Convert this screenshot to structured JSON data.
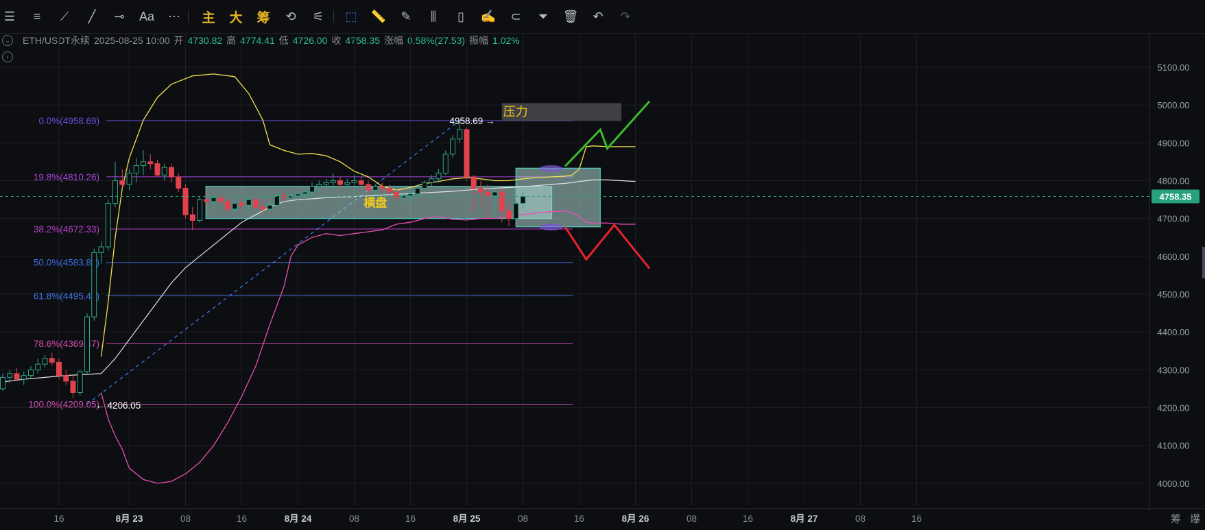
{
  "toolbar": {
    "items": [
      {
        "icon": "menu-icon",
        "glyph": "☰"
      },
      {
        "icon": "horizontal-lines-icon",
        "glyph": "≡"
      },
      {
        "icon": "trend-line-icon",
        "glyph": "⟋"
      },
      {
        "icon": "ray-line-icon",
        "glyph": "╱"
      },
      {
        "icon": "horizontal-ray-icon",
        "glyph": "⊸"
      },
      {
        "icon": "text-tool-icon",
        "glyph": "Aa"
      },
      {
        "icon": "more-icon",
        "glyph": "⋯"
      }
    ],
    "cn_buttons": [
      "主",
      "大",
      "筹"
    ],
    "tools": [
      {
        "icon": "rotate-icon",
        "glyph": "⟲"
      },
      {
        "icon": "signal-icon",
        "glyph": "⚟"
      },
      {
        "icon": "select-icon",
        "glyph": "⬚",
        "active": true
      },
      {
        "icon": "ruler-icon",
        "glyph": "📏"
      },
      {
        "icon": "brush-icon",
        "glyph": "✎"
      },
      {
        "icon": "candle-pattern-icon",
        "glyph": "⫼"
      },
      {
        "icon": "clipboard-icon",
        "glyph": "▯"
      },
      {
        "icon": "note-icon",
        "glyph": "✍"
      },
      {
        "icon": "magnet-icon",
        "glyph": "⊂"
      },
      {
        "icon": "filter-icon",
        "glyph": "⏷"
      },
      {
        "icon": "trash-icon",
        "glyph": "🗑"
      },
      {
        "icon": "undo-icon",
        "glyph": "↶"
      },
      {
        "icon": "redo-icon",
        "glyph": "↷",
        "disabled": true
      }
    ]
  },
  "infobar": {
    "symbol": "ETH/USDT永续",
    "datetime": "2025-08-25 10:00",
    "open_label": "开",
    "open": "4730.82",
    "high_label": "高",
    "high": "4774.41",
    "low_label": "低",
    "low": "4726.00",
    "close_label": "收",
    "close": "4758.35",
    "change_label": "涨幅",
    "change": "0.58%(27.53)",
    "amp_label": "振幅",
    "amp": "1.02%"
  },
  "corner": {
    "left": "筹",
    "right": "爆"
  },
  "colors": {
    "background": "#0d0e12",
    "up": "#2fa88a",
    "down": "#e0424e",
    "grid": "#1c1e23",
    "price_badge": "#26a17b"
  },
  "chart_data": {
    "type": "candlestick",
    "symbol": "ETH/USDT永续",
    "y_range": [
      3940,
      5170
    ],
    "y_ticks": [
      4000,
      4100,
      4200,
      4300,
      4400,
      4500,
      4600,
      4700,
      4800,
      4900,
      5000,
      5100
    ],
    "y_tick_labels": [
      "4000.00",
      "4100.00",
      "4200.00",
      "4300.00",
      "4400.00",
      "4500.00",
      "4600.00",
      "4700.00",
      "4800.00",
      "4900.00",
      "5000.00",
      "5100.00"
    ],
    "x_ticks": [
      {
        "label": "16",
        "bar": 8,
        "bold": false
      },
      {
        "label": "8月 23",
        "bar": 18,
        "bold": true
      },
      {
        "label": "08",
        "bar": 26,
        "bold": false
      },
      {
        "label": "16",
        "bar": 34,
        "bold": false
      },
      {
        "label": "8月 24",
        "bar": 42,
        "bold": true
      },
      {
        "label": "08",
        "bar": 50,
        "bold": false
      },
      {
        "label": "16",
        "bar": 58,
        "bold": false
      },
      {
        "label": "8月 25",
        "bar": 66,
        "bold": true
      },
      {
        "label": "08",
        "bar": 74,
        "bold": false
      },
      {
        "label": "16",
        "bar": 82,
        "bold": false
      },
      {
        "label": "8月 26",
        "bar": 90,
        "bold": true
      },
      {
        "label": "08",
        "bar": 98,
        "bold": false
      },
      {
        "label": "16",
        "bar": 106,
        "bold": false
      },
      {
        "label": "8月 27",
        "bar": 114,
        "bold": true
      },
      {
        "label": "08",
        "bar": 122,
        "bold": false
      },
      {
        "label": "16",
        "bar": 130,
        "bold": false
      }
    ],
    "current_price": 4758.35,
    "current_price_label": "4758.35",
    "candles": [
      [
        4250,
        4290,
        4245,
        4280
      ],
      [
        4280,
        4300,
        4265,
        4290
      ],
      [
        4290,
        4305,
        4270,
        4275
      ],
      [
        4275,
        4295,
        4260,
        4285
      ],
      [
        4285,
        4310,
        4275,
        4300
      ],
      [
        4300,
        4330,
        4290,
        4315
      ],
      [
        4315,
        4340,
        4305,
        4330
      ],
      [
        4330,
        4345,
        4310,
        4320
      ],
      [
        4320,
        4330,
        4275,
        4285
      ],
      [
        4285,
        4300,
        4260,
        4270
      ],
      [
        4270,
        4285,
        4225,
        4240
      ],
      [
        4240,
        4300,
        4232,
        4295
      ],
      [
        4295,
        4450,
        4290,
        4440
      ],
      [
        4440,
        4620,
        4430,
        4610
      ],
      [
        4610,
        4640,
        4580,
        4625
      ],
      [
        4625,
        4750,
        4615,
        4740
      ],
      [
        4740,
        4850,
        4730,
        4800
      ],
      [
        4800,
        4830,
        4780,
        4790
      ],
      [
        4790,
        4830,
        4775,
        4820
      ],
      [
        4820,
        4860,
        4795,
        4840
      ],
      [
        4840,
        4880,
        4815,
        4850
      ],
      [
        4850,
        4870,
        4830,
        4845
      ],
      [
        4845,
        4855,
        4810,
        4815
      ],
      [
        4815,
        4845,
        4800,
        4835
      ],
      [
        4835,
        4845,
        4795,
        4810
      ],
      [
        4810,
        4820,
        4770,
        4780
      ],
      [
        4780,
        4790,
        4700,
        4710
      ],
      [
        4710,
        4730,
        4670,
        4695
      ],
      [
        4695,
        4760,
        4690,
        4750
      ],
      [
        4750,
        4770,
        4730,
        4745
      ],
      [
        4745,
        4760,
        4725,
        4755
      ],
      [
        4755,
        4765,
        4735,
        4745
      ],
      [
        4745,
        4755,
        4715,
        4725
      ],
      [
        4725,
        4760,
        4715,
        4740
      ],
      [
        4740,
        4755,
        4725,
        4735
      ],
      [
        4735,
        4760,
        4725,
        4750
      ],
      [
        4750,
        4760,
        4720,
        4730
      ],
      [
        4730,
        4745,
        4715,
        4725
      ],
      [
        4725,
        4745,
        4715,
        4735
      ],
      [
        4735,
        4770,
        4725,
        4760
      ],
      [
        4760,
        4775,
        4745,
        4755
      ],
      [
        4755,
        4770,
        4740,
        4760
      ],
      [
        4760,
        4770,
        4745,
        4765
      ],
      [
        4765,
        4780,
        4750,
        4770
      ],
      [
        4770,
        4795,
        4760,
        4785
      ],
      [
        4785,
        4800,
        4770,
        4790
      ],
      [
        4790,
        4805,
        4775,
        4795
      ],
      [
        4795,
        4820,
        4780,
        4800
      ],
      [
        4800,
        4810,
        4780,
        4790
      ],
      [
        4790,
        4805,
        4775,
        4795
      ],
      [
        4795,
        4815,
        4780,
        4800
      ],
      [
        4800,
        4810,
        4785,
        4790
      ],
      [
        4790,
        4800,
        4765,
        4775
      ],
      [
        4775,
        4790,
        4765,
        4785
      ],
      [
        4785,
        4795,
        4770,
        4780
      ],
      [
        4780,
        4790,
        4760,
        4770
      ],
      [
        4770,
        4780,
        4745,
        4755
      ],
      [
        4755,
        4770,
        4740,
        4760
      ],
      [
        4760,
        4775,
        4745,
        4765
      ],
      [
        4765,
        4790,
        4755,
        4780
      ],
      [
        4780,
        4800,
        4770,
        4795
      ],
      [
        4795,
        4815,
        4785,
        4805
      ],
      [
        4805,
        4830,
        4795,
        4820
      ],
      [
        4820,
        4880,
        4815,
        4870
      ],
      [
        4870,
        4920,
        4860,
        4910
      ],
      [
        4910,
        4958.69,
        4900,
        4935
      ],
      [
        4935,
        4940,
        4800,
        4810
      ],
      [
        4810,
        4815,
        4720,
        4780
      ],
      [
        4780,
        4800,
        4730,
        4770
      ],
      [
        4770,
        4790,
        4700,
        4760
      ],
      [
        4760,
        4775,
        4700,
        4770
      ],
      [
        4770,
        4780,
        4690,
        4720
      ],
      [
        4720,
        4740,
        4680,
        4700
      ],
      [
        4700,
        4750,
        4695,
        4740
      ],
      [
        4740,
        4775,
        4726,
        4758.35
      ]
    ],
    "bollinger": {
      "upper": [
        [
          14,
          4335
        ],
        [
          15,
          4480
        ],
        [
          16,
          4650
        ],
        [
          17,
          4780
        ],
        [
          18,
          4860
        ],
        [
          20,
          4960
        ],
        [
          22,
          5020
        ],
        [
          24,
          5055
        ],
        [
          27,
          5077
        ],
        [
          30,
          5082
        ],
        [
          33,
          5075
        ],
        [
          35,
          5030
        ],
        [
          37,
          4960
        ],
        [
          38,
          4895
        ],
        [
          40,
          4880
        ],
        [
          42,
          4870
        ],
        [
          44,
          4872
        ],
        [
          46,
          4866
        ],
        [
          48,
          4850
        ],
        [
          50,
          4825
        ],
        [
          52,
          4810
        ],
        [
          54,
          4785
        ],
        [
          56,
          4775
        ],
        [
          58,
          4782
        ],
        [
          60,
          4792
        ],
        [
          62,
          4798
        ],
        [
          64,
          4805
        ],
        [
          66,
          4808
        ],
        [
          68,
          4805
        ],
        [
          70,
          4800
        ],
        [
          72,
          4800
        ],
        [
          74,
          4805
        ],
        [
          76,
          4808
        ],
        [
          78,
          4810
        ],
        [
          80,
          4812
        ],
        [
          81,
          4815
        ],
        [
          82,
          4830
        ],
        [
          83,
          4890
        ],
        [
          84,
          4892
        ],
        [
          86,
          4890
        ],
        [
          88,
          4890
        ],
        [
          90,
          4890
        ]
      ],
      "middle": [
        [
          0,
          4268
        ],
        [
          3,
          4275
        ],
        [
          6,
          4280
        ],
        [
          9,
          4285
        ],
        [
          12,
          4288
        ],
        [
          14,
          4290
        ],
        [
          16,
          4330
        ],
        [
          18,
          4380
        ],
        [
          20,
          4430
        ],
        [
          22,
          4480
        ],
        [
          24,
          4530
        ],
        [
          26,
          4570
        ],
        [
          28,
          4600
        ],
        [
          30,
          4630
        ],
        [
          32,
          4660
        ],
        [
          34,
          4690
        ],
        [
          36,
          4710
        ],
        [
          38,
          4730
        ],
        [
          40,
          4745
        ],
        [
          42,
          4750
        ],
        [
          44,
          4752
        ],
        [
          46,
          4755
        ],
        [
          48,
          4757
        ],
        [
          50,
          4758
        ],
        [
          52,
          4760
        ],
        [
          54,
          4762
        ],
        [
          56,
          4764
        ],
        [
          58,
          4766
        ],
        [
          60,
          4768
        ],
        [
          62,
          4770
        ],
        [
          64,
          4772
        ],
        [
          66,
          4775
        ],
        [
          68,
          4778
        ],
        [
          70,
          4780
        ],
        [
          72,
          4782
        ],
        [
          74,
          4784
        ],
        [
          76,
          4787
        ],
        [
          78,
          4790
        ],
        [
          80,
          4793
        ],
        [
          81,
          4795
        ],
        [
          82,
          4798
        ],
        [
          83,
          4800
        ],
        [
          84,
          4802
        ],
        [
          86,
          4802
        ],
        [
          88,
          4800
        ],
        [
          90,
          4798
        ]
      ],
      "lower": [
        [
          14,
          4240
        ],
        [
          15,
          4170
        ],
        [
          16,
          4125
        ],
        [
          17,
          4090
        ],
        [
          18,
          4040
        ],
        [
          20,
          4010
        ],
        [
          22,
          4000
        ],
        [
          24,
          4005
        ],
        [
          26,
          4025
        ],
        [
          28,
          4055
        ],
        [
          30,
          4100
        ],
        [
          32,
          4160
        ],
        [
          34,
          4230
        ],
        [
          36,
          4310
        ],
        [
          38,
          4420
        ],
        [
          40,
          4520
        ],
        [
          41,
          4600
        ],
        [
          42,
          4630
        ],
        [
          44,
          4650
        ],
        [
          46,
          4660
        ],
        [
          48,
          4655
        ],
        [
          50,
          4660
        ],
        [
          52,
          4665
        ],
        [
          54,
          4670
        ],
        [
          56,
          4685
        ],
        [
          58,
          4690
        ],
        [
          60,
          4700
        ],
        [
          62,
          4705
        ],
        [
          64,
          4698
        ],
        [
          66,
          4696
        ],
        [
          68,
          4700
        ],
        [
          70,
          4700
        ],
        [
          72,
          4705
        ],
        [
          74,
          4710
        ],
        [
          76,
          4715
        ],
        [
          78,
          4718
        ],
        [
          80,
          4720
        ],
        [
          81,
          4715
        ],
        [
          82,
          4705
        ],
        [
          83,
          4690
        ],
        [
          84,
          4688
        ],
        [
          86,
          4688
        ],
        [
          88,
          4685
        ],
        [
          90,
          4685
        ]
      ]
    },
    "fibonacci": [
      {
        "level": 4958.69,
        "label": "0.0%(4958.69)",
        "color": "#6c4fe0"
      },
      {
        "level": 4810.26,
        "label": "19.8%(4810.26)",
        "color": "#a545d6"
      },
      {
        "level": 4672.33,
        "label": "38.2%(4672.33)",
        "color": "#b840c8"
      },
      {
        "level": 4583.87,
        "label": "50.0%(4583.87)",
        "color": "#3f6fe0"
      },
      {
        "level": 4495.41,
        "label": "61.8%(4495.41)",
        "color": "#3f74e0"
      },
      {
        "level": 4369.47,
        "label": "78.6%(4369.47)",
        "color": "#d64eb0"
      },
      {
        "level": 4209.05,
        "label": "100.0%(4209.05)",
        "color": "#d64eb0"
      }
    ],
    "annotations": {
      "high_marker": "4958.69",
      "low_marker": "4206.05",
      "range_label": "横盘",
      "pressure_label": "压力"
    }
  }
}
